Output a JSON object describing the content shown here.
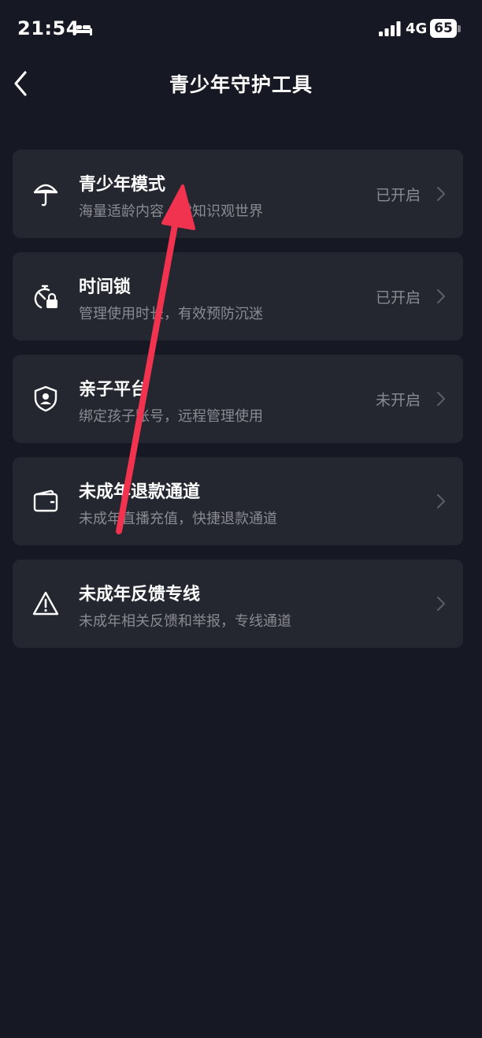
{
  "status_bar": {
    "time": "21:54",
    "sleep_icon": "bed-icon",
    "network": "4G",
    "battery": "65"
  },
  "header": {
    "title": "青少年守护工具",
    "back_icon": "chevron-left-icon"
  },
  "menu": [
    {
      "icon": "umbrella-icon",
      "title": "青少年模式",
      "subtitle": "海量适龄内容，学知识观世界",
      "status": "已开启"
    },
    {
      "icon": "timer-lock-icon",
      "title": "时间锁",
      "subtitle": "管理使用时长，有效预防沉迷",
      "status": "已开启"
    },
    {
      "icon": "shield-user-icon",
      "title": "亲子平台",
      "subtitle": "绑定孩子账号，远程管理使用",
      "status": "未开启"
    },
    {
      "icon": "wallet-icon",
      "title": "未成年退款通道",
      "subtitle": "未成年直播充值，快捷退款通道",
      "status": ""
    },
    {
      "icon": "warning-icon",
      "title": "未成年反馈专线",
      "subtitle": "未成年相关反馈和举报，专线通道",
      "status": ""
    }
  ],
  "colors": {
    "background": "#161823",
    "card": "#242630",
    "secondary_text": "#8a8b92",
    "annotation_arrow": "#f2334f"
  }
}
